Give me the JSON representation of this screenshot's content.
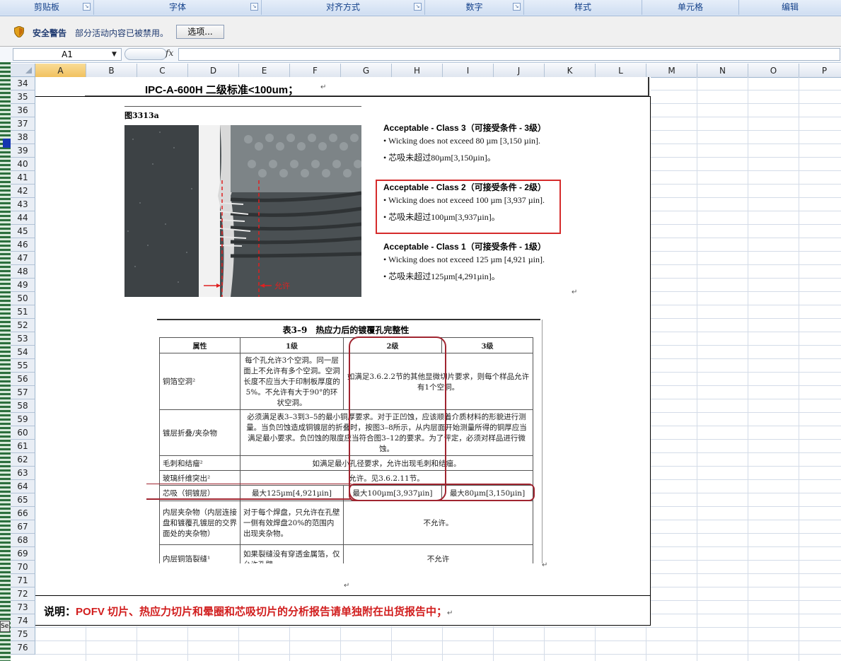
{
  "ribbon": {
    "groups": [
      {
        "label": "剪贴板"
      },
      {
        "label": "字体"
      },
      {
        "label": "对齐方式"
      },
      {
        "label": "数字"
      },
      {
        "label": "样式"
      },
      {
        "label": "单元格"
      },
      {
        "label": "编辑"
      }
    ]
  },
  "security_bar": {
    "title": "安全警告",
    "message": "部分活动内容已被禁用。",
    "options_button": "选项..."
  },
  "formula_bar": {
    "name_box": "A1",
    "fx_label": "fx",
    "formula": ""
  },
  "columns": [
    "A",
    "B",
    "C",
    "D",
    "E",
    "F",
    "G",
    "H",
    "I",
    "J",
    "K",
    "L",
    "M",
    "N",
    "O",
    "P"
  ],
  "selected_column": "A",
  "rows": [
    "34",
    "35",
    "36",
    "37",
    "38",
    "39",
    "40",
    "41",
    "42",
    "43",
    "44",
    "45",
    "46",
    "47",
    "48",
    "49",
    "50",
    "51",
    "52",
    "53",
    "54",
    "55",
    "56",
    "57",
    "58",
    "59",
    "60",
    "61",
    "62",
    "63",
    "64",
    "65",
    "66",
    "67",
    "68",
    "69",
    "70",
    "71",
    "72",
    "73",
    "74",
    "75",
    "76"
  ],
  "document": {
    "title": "IPC-A-600H 二级标准<100um；",
    "paragraph_mark": "↵",
    "figure_label": "图3313a",
    "figure_annotation": "允许",
    "acceptance": [
      {
        "heading": "Acceptable - Class 3（可接受条件 - 3级）",
        "line_en": "• Wicking does not exceed 80 µm [3,150 µin].",
        "line_cn": "• 芯吸未超过80µm[3,150µin]。"
      },
      {
        "heading": "Acceptable - Class 2（可接受条件 - 2级）",
        "line_en": "• Wicking does not exceed 100 µm [3,937 µin].",
        "line_cn": "• 芯吸未超过100µm[3,937µin]。"
      },
      {
        "heading": "Acceptable - Class 1（可接受条件 - 1级）",
        "line_en": "• Wicking does not exceed 125 µm [4,921 µin].",
        "line_cn": "• 芯吸未超过125µm[4,291µin]。"
      }
    ],
    "table": {
      "title": "表3–9　热应力后的镀覆孔完整性",
      "headers": [
        "属性",
        "1级",
        "2级",
        "3级"
      ],
      "rows": {
        "copper_void": {
          "attr": "铜箔空洞²",
          "c1": "每个孔允许3个空洞。同一层面上不允许有多个空洞。空洞长度不应当大于印制板厚度的5%。不允许有大于90°的环状空洞。",
          "c23": "如满足3.6.2.2节的其他显微切片要求，则每个样品允许有1个空洞。"
        },
        "fold": {
          "attr": "镀层折叠/夹杂物",
          "c123": "必须满足表3–3到3–5的最小铜厚要求。对于正凹蚀，应该顺着介质材料的形貌进行测量。当负凹蚀造成铜镀层的折叠时，按图3–8所示，从内层面开始测量所得的铜厚应当满足最小要求。负凹蚀的限度应当符合图3–12的要求。为了评定，必须对样品进行微蚀。"
        },
        "burr": {
          "attr": "毛刺和结瘤²",
          "c123": "如满足最小孔径要求，允许出现毛刺和结瘤。"
        },
        "glass": {
          "attr": "玻璃纤维突出²",
          "c123": "允许。见3.6.2.11节。"
        },
        "wicking": {
          "attr": "芯吸（铜镀层）",
          "c1": "最大125µm[4,921µin]",
          "c2": "最大100µm[3,937µin]",
          "c3": "最大80µm[3,150µin]"
        },
        "inclusion": {
          "attr": "内层夹杂物（内层连接盘和镀覆孔镀层的交界面处的夹杂物）",
          "c1": "对于每个焊盘，只允许在孔壁一侧有效焊盘20%的范围内出现夹杂物。",
          "c23": "不允许。"
        },
        "crack": {
          "attr": "内层铜箔裂缝¹",
          "c1": "如果裂缝没有穿透金属箔，仅允许孔壁一",
          "c23": "不允许"
        }
      }
    },
    "note_label": "说明：",
    "note_text": "POFV 切片、热应力切片和晕圈和芯吸切片的分析报告请单独附在出货报告中；"
  },
  "left_tab_text": "Se",
  "colors": {
    "ribbon_text": "#15428b",
    "highlight_red": "#d52b2b",
    "note_red": "#d11d1d",
    "selected_header": "#f1c15f"
  }
}
